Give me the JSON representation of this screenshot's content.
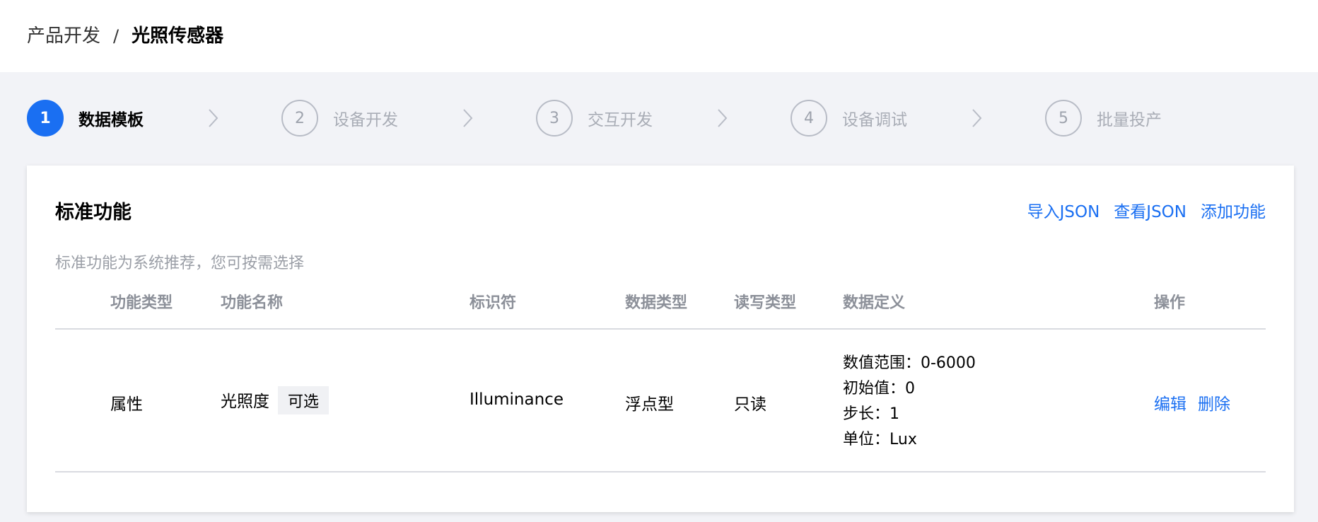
{
  "breadcrumb": {
    "parent": "产品开发",
    "separator": "/",
    "current": "光照传感器"
  },
  "steps": [
    {
      "number": "1",
      "label": "数据模板",
      "active": true
    },
    {
      "number": "2",
      "label": "设备开发",
      "active": false
    },
    {
      "number": "3",
      "label": "交互开发",
      "active": false
    },
    {
      "number": "4",
      "label": "设备调试",
      "active": false
    },
    {
      "number": "5",
      "label": "批量投产",
      "active": false
    }
  ],
  "card": {
    "title": "标准功能",
    "actions": {
      "import_json": "导入JSON",
      "view_json": "查看JSON",
      "add_function": "添加功能"
    },
    "description": "标准功能为系统推荐，您可按需选择"
  },
  "table": {
    "columns": [
      "功能类型",
      "功能名称",
      "标识符",
      "数据类型",
      "读写类型",
      "数据定义",
      "操作"
    ],
    "rows": [
      {
        "type": "属性",
        "name": "光照度",
        "tag": "可选",
        "identifier": "Illuminance",
        "data_type": "浮点型",
        "rw_type": "只读",
        "definition": [
          "数值范围：0-6000",
          "初始值：0",
          "步长：1",
          "单位：Lux"
        ],
        "actions": {
          "edit": "编辑",
          "delete": "删除"
        }
      }
    ]
  },
  "colors": {
    "accent": "#1a6ff2",
    "background": "#f2f3f7",
    "muted_text": "#9a9ea6"
  }
}
